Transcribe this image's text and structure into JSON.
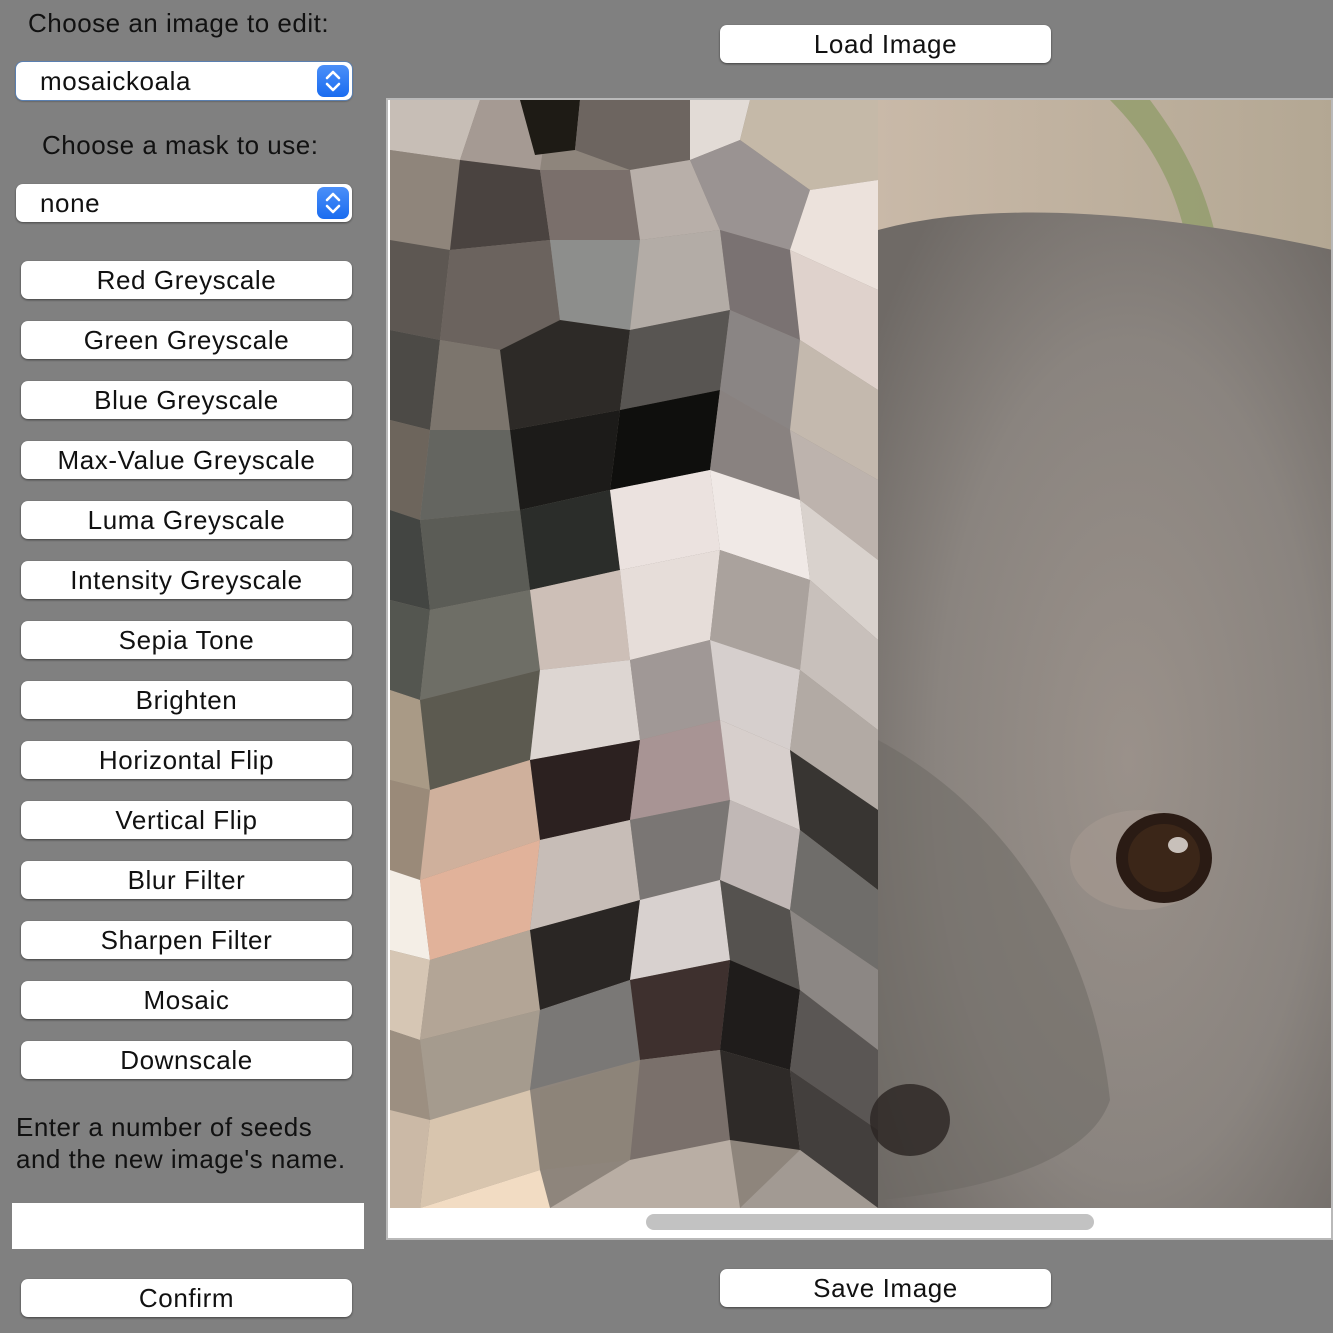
{
  "left_panel": {
    "image_label": "Choose an image to edit:",
    "image_select": {
      "value": "mosaickoala",
      "icon": "select-arrows-icon"
    },
    "mask_label": "Choose a mask to use:",
    "mask_select": {
      "value": "none",
      "icon": "select-arrows-icon"
    },
    "buttons": [
      "Red Greyscale",
      "Green Greyscale",
      "Blue Greyscale",
      "Max-Value Greyscale",
      "Luma Greyscale",
      "Intensity Greyscale",
      "Sepia Tone",
      "Brighten",
      "Horizontal Flip",
      "Vertical Flip",
      "Blur Filter",
      "Sharpen Filter",
      "Mosaic",
      "Downscale"
    ],
    "seeds_prompt_line1": "Enter a number of seeds",
    "seeds_prompt_line2": "and the new image's name.",
    "seeds_input_value": "",
    "confirm_label": "Confirm"
  },
  "top": {
    "load_label": "Load Image"
  },
  "bottom": {
    "save_label": "Save Image"
  },
  "colors": {
    "background": "#808080",
    "button": "#ffffff",
    "select_accent": "#2a7af3"
  }
}
